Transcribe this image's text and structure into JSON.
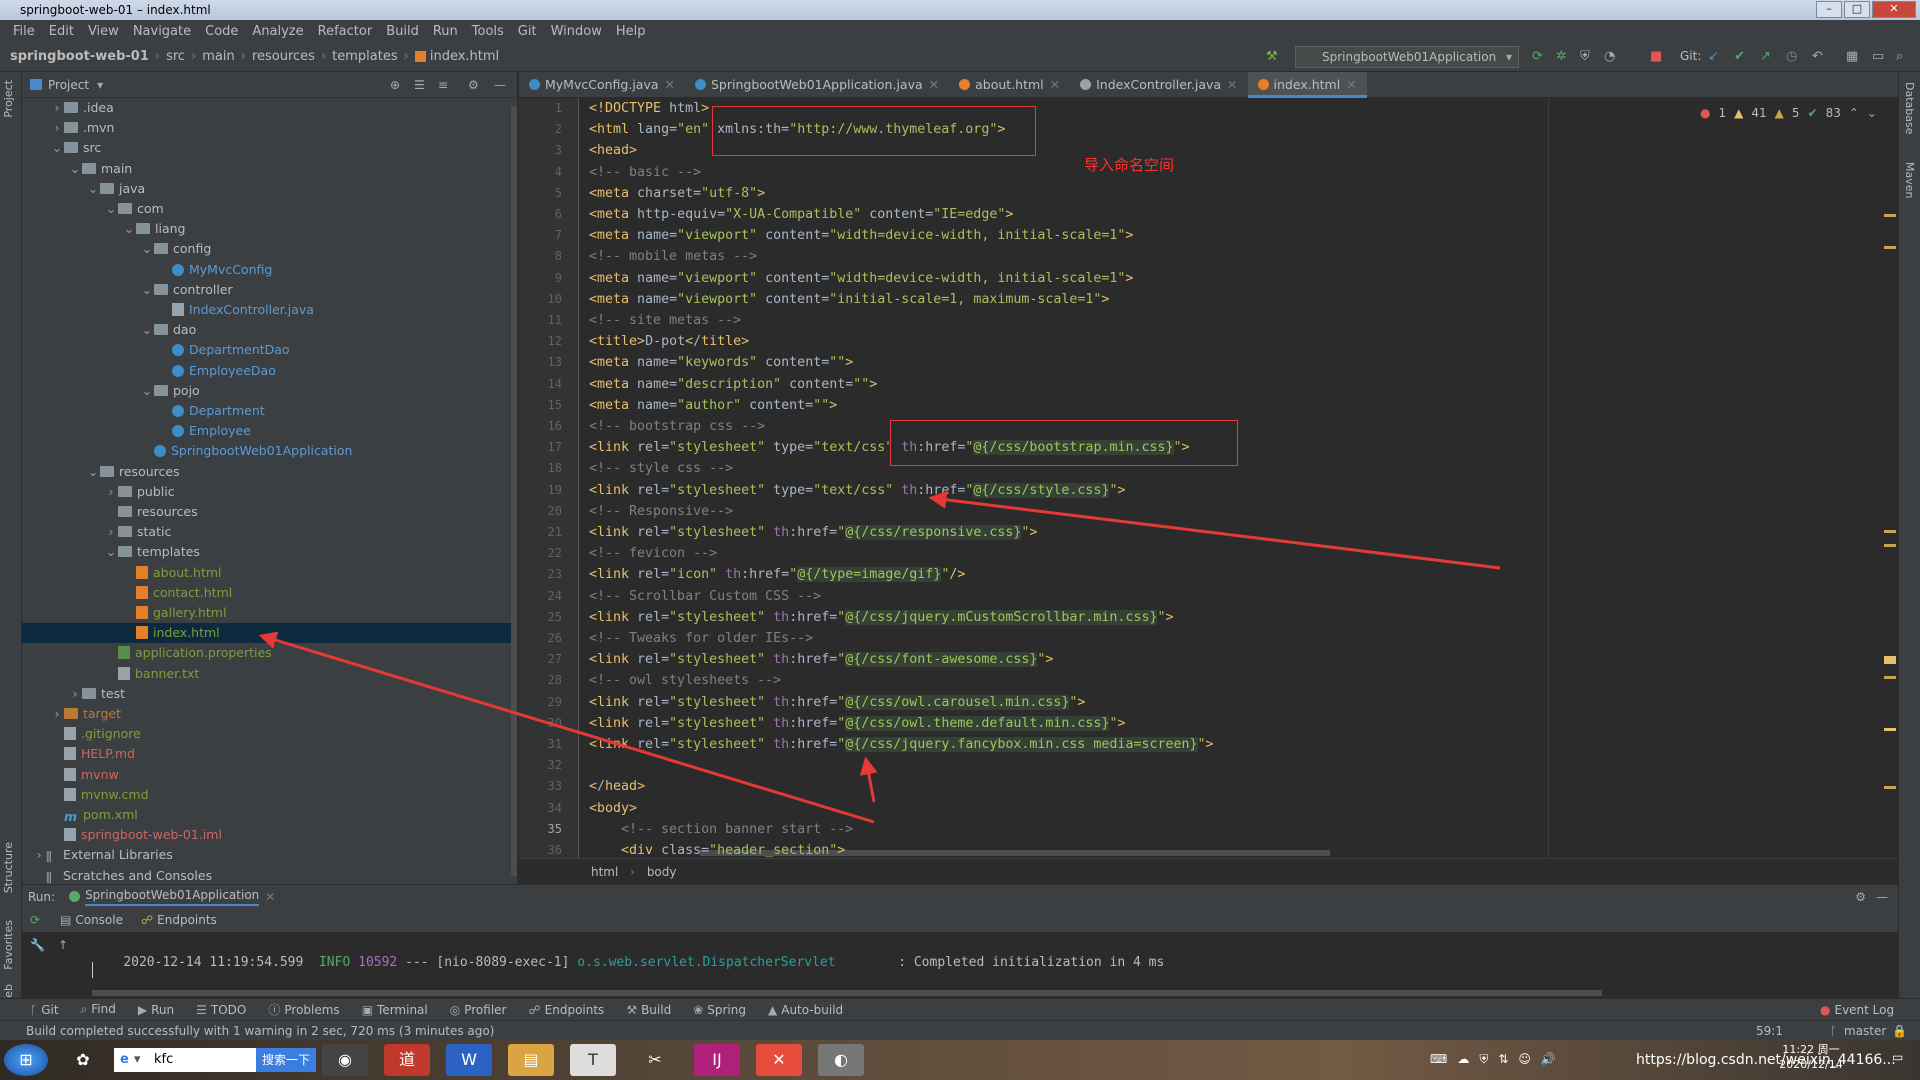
{
  "window": {
    "title": "springboot-web-01 – index.html"
  },
  "menu": [
    "File",
    "Edit",
    "View",
    "Navigate",
    "Code",
    "Analyze",
    "Refactor",
    "Build",
    "Run",
    "Tools",
    "Git",
    "Window",
    "Help"
  ],
  "breadcrumb": [
    "springboot-web-01",
    "src",
    "main",
    "resources",
    "templates",
    "index.html"
  ],
  "run_config": "SpringbootWeb01Application",
  "git_label": "Git:",
  "project_panel": {
    "title": "Project"
  },
  "tree": [
    {
      "label": ".idea",
      "indent": 1,
      "arrow": ">",
      "kind": "folder",
      "color": "c-def"
    },
    {
      "label": ".mvn",
      "indent": 1,
      "arrow": ">",
      "kind": "folder",
      "color": "c-def"
    },
    {
      "label": "src",
      "indent": 1,
      "arrow": "v",
      "kind": "folder",
      "color": "c-def"
    },
    {
      "label": "main",
      "indent": 2,
      "arrow": "v",
      "kind": "folder",
      "color": "c-def"
    },
    {
      "label": "java",
      "indent": 3,
      "arrow": "v",
      "kind": "folder",
      "color": "c-def"
    },
    {
      "label": "com",
      "indent": 4,
      "arrow": "v",
      "kind": "folder",
      "color": "c-def"
    },
    {
      "label": "liang",
      "indent": 5,
      "arrow": "v",
      "kind": "folder",
      "color": "c-def"
    },
    {
      "label": "config",
      "indent": 6,
      "arrow": "v",
      "kind": "folder",
      "color": "c-def"
    },
    {
      "label": "MyMvcConfig",
      "indent": 7,
      "arrow": "",
      "kind": "cls",
      "color": "c-blue"
    },
    {
      "label": "controller",
      "indent": 6,
      "arrow": "v",
      "kind": "folder",
      "color": "c-def"
    },
    {
      "label": "IndexController.java",
      "indent": 7,
      "arrow": "",
      "kind": "txt",
      "color": "c-blue"
    },
    {
      "label": "dao",
      "indent": 6,
      "arrow": "v",
      "kind": "folder",
      "color": "c-def"
    },
    {
      "label": "DepartmentDao",
      "indent": 7,
      "arrow": "",
      "kind": "cls",
      "color": "c-blue"
    },
    {
      "label": "EmployeeDao",
      "indent": 7,
      "arrow": "",
      "kind": "cls",
      "color": "c-blue"
    },
    {
      "label": "pojo",
      "indent": 6,
      "arrow": "v",
      "kind": "folder",
      "color": "c-def"
    },
    {
      "label": "Department",
      "indent": 7,
      "arrow": "",
      "kind": "cls",
      "color": "c-blue"
    },
    {
      "label": "Employee",
      "indent": 7,
      "arrow": "",
      "kind": "cls",
      "color": "c-blue"
    },
    {
      "label": "SpringbootWeb01Application",
      "indent": 6,
      "arrow": "",
      "kind": "cls",
      "color": "c-blue"
    },
    {
      "label": "resources",
      "indent": 3,
      "arrow": "v",
      "kind": "folder",
      "color": "c-def"
    },
    {
      "label": "public",
      "indent": 4,
      "arrow": ">",
      "kind": "folder",
      "color": "c-def"
    },
    {
      "label": "resources",
      "indent": 4,
      "arrow": "",
      "kind": "folder",
      "color": "c-def"
    },
    {
      "label": "static",
      "indent": 4,
      "arrow": ">",
      "kind": "folder",
      "color": "c-def"
    },
    {
      "label": "templates",
      "indent": 4,
      "arrow": "v",
      "kind": "folder",
      "color": "c-def"
    },
    {
      "label": "about.html",
      "indent": 5,
      "arrow": "",
      "kind": "html",
      "color": "c-olive"
    },
    {
      "label": "contact.html",
      "indent": 5,
      "arrow": "",
      "kind": "html",
      "color": "c-olive"
    },
    {
      "label": "gallery.html",
      "indent": 5,
      "arrow": "",
      "kind": "html",
      "color": "c-olive"
    },
    {
      "label": "index.html",
      "indent": 5,
      "arrow": "",
      "kind": "html",
      "color": "c-olive",
      "selected": true
    },
    {
      "label": "application.properties",
      "indent": 4,
      "arrow": "",
      "kind": "prop",
      "color": "c-olive"
    },
    {
      "label": "banner.txt",
      "indent": 4,
      "arrow": "",
      "kind": "txt",
      "color": "c-olive"
    },
    {
      "label": "test",
      "indent": 2,
      "arrow": ">",
      "kind": "folder",
      "color": "c-def"
    },
    {
      "label": "target",
      "indent": 1,
      "arrow": ">",
      "kind": "folder-orange",
      "color": "c-orange"
    },
    {
      "label": ".gitignore",
      "indent": 1,
      "arrow": "",
      "kind": "txt",
      "color": "c-olive"
    },
    {
      "label": "HELP.md",
      "indent": 1,
      "arrow": "",
      "kind": "txt",
      "color": "c-red"
    },
    {
      "label": "mvnw",
      "indent": 1,
      "arrow": "",
      "kind": "txt",
      "color": "c-red"
    },
    {
      "label": "mvnw.cmd",
      "indent": 1,
      "arrow": "",
      "kind": "txt",
      "color": "c-olive"
    },
    {
      "label": "pom.xml",
      "indent": 1,
      "arrow": "",
      "kind": "m",
      "color": "c-olive"
    },
    {
      "label": "springboot-web-01.iml",
      "indent": 1,
      "arrow": "",
      "kind": "txt",
      "color": "c-red"
    },
    {
      "label": "External Libraries",
      "indent": 0,
      "arrow": ">",
      "kind": "lib",
      "color": "c-def"
    },
    {
      "label": "Scratches and Consoles",
      "indent": 0,
      "arrow": "",
      "kind": "lib",
      "color": "c-def"
    }
  ],
  "tabs": [
    {
      "label": "MyMvcConfig.java",
      "icon": "#3d8dc6",
      "active": false
    },
    {
      "label": "SpringbootWeb01Application.java",
      "icon": "#3d8dc6",
      "active": false
    },
    {
      "label": "about.html",
      "icon": "#e4802a",
      "active": false
    },
    {
      "label": "IndexController.java",
      "icon": "#98a4ad",
      "active": false
    },
    {
      "label": "index.html",
      "icon": "#e4802a",
      "active": true
    }
  ],
  "inspections": {
    "errors": "1",
    "warnings": "41",
    "weak": "5",
    "ok": "83"
  },
  "code_lines": [
    "<!DOCTYPE html>",
    "<html lang=\"en\" xmlns:th=\"http://www.thymeleaf.org\">",
    "<head>",
    "<!-- basic -->",
    "<meta charset=\"utf-8\">",
    "<meta http-equiv=\"X-UA-Compatible\" content=\"IE=edge\">",
    "<meta name=\"viewport\" content=\"width=device-width, initial-scale=1\">",
    "<!-- mobile metas -->",
    "<meta name=\"viewport\" content=\"width=device-width, initial-scale=1\">",
    "<meta name=\"viewport\" content=\"initial-scale=1, maximum-scale=1\">",
    "<!-- site metas -->",
    "<title>D-pot</title>",
    "<meta name=\"keywords\" content=\"\">",
    "<meta name=\"description\" content=\"\">",
    "<meta name=\"author\" content=\"\">",
    "<!-- bootstrap css -->",
    "<link rel=\"stylesheet\" type=\"text/css\" th:href=\"@{/css/bootstrap.min.css}\">",
    "<!-- style css -->",
    "<link rel=\"stylesheet\" type=\"text/css\" th:href=\"@{/css/style.css}\">",
    "<!-- Responsive-->",
    "<link rel=\"stylesheet\" th:href=\"@{/css/responsive.css}\">",
    "<!-- fevicon -->",
    "<link rel=\"icon\" th:href=\"@{/type=image/gif}\"/>",
    "<!-- Scrollbar Custom CSS -->",
    "<link rel=\"stylesheet\" th:href=\"@{/css/jquery.mCustomScrollbar.min.css}\">",
    "<!-- Tweaks for older IEs-->",
    "<link rel=\"stylesheet\" th:href=\"@{/css/font-awesome.css}\">",
    "<!-- owl stylesheets -->",
    "<link rel=\"stylesheet\" th:href=\"@{/css/owl.carousel.min.css}\">",
    "<link rel=\"stylesheet\" th:href=\"@{/css/owl.theme.default.min.css}\">",
    "<link rel=\"stylesheet\" th:href=\"@{/css/jquery.fancybox.min.css media=screen}\">",
    "",
    "</head>",
    "<body>",
    "    <!-- section banner start -->",
    "    <div class=\"header_section\">"
  ],
  "annotation": "导入命名空间",
  "editor_breadcrumb": [
    "html",
    "body"
  ],
  "run_panel": {
    "label": "Run:",
    "app": "SpringbootWeb01Application",
    "console_tab": "Console",
    "endpoints_tab": "Endpoints",
    "log_time": "2020-12-14 11:19:54.599",
    "log_level": "INFO",
    "log_pid": "10592",
    "log_sep": "---",
    "log_thread": "[nio-8089-exec-1]",
    "log_logger": "o.s.web.servlet.DispatcherServlet",
    "log_msg": ": Completed initialization in 4 ms"
  },
  "tool_windows": [
    "Git",
    "Find",
    "Run",
    "TODO",
    "Problems",
    "Terminal",
    "Profiler",
    "Endpoints",
    "Build",
    "Spring",
    "Auto-build"
  ],
  "event_log": "Event Log",
  "status": {
    "message": "Build completed successfully with 1 warning in 2 sec, 720 ms (3 minutes ago)",
    "position": "59:1",
    "branch": "master"
  },
  "side_labels": {
    "left": [
      "Project",
      "Structure",
      "Favorites",
      "Web"
    ],
    "right": [
      "Database",
      "Maven"
    ]
  },
  "taskbar": {
    "search_text": "kfc",
    "search_button": "搜索一下",
    "time": "11:22 周一",
    "date": "2020/12/14",
    "watermark": "https://blog.csdn.net/weixin_44166..."
  }
}
